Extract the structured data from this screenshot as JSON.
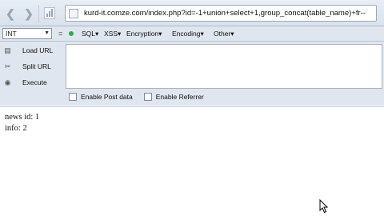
{
  "address_bar": {
    "url": "kurd-it.comze.com/index.php?id=-1+union+select+1,group_concat(table_name)+fr--"
  },
  "hackbar": {
    "selector_value": "INT",
    "minus_label": "=",
    "menus": [
      "SQL",
      "XSS",
      "Encryption",
      "Encoding",
      "Other"
    ],
    "side_buttons": [
      "Load URL",
      "Split URL",
      "Execute"
    ],
    "options": [
      "Enable Post data",
      "Enable Referrer"
    ]
  },
  "page": {
    "lines": [
      "news id: 1",
      "info: 2"
    ]
  }
}
